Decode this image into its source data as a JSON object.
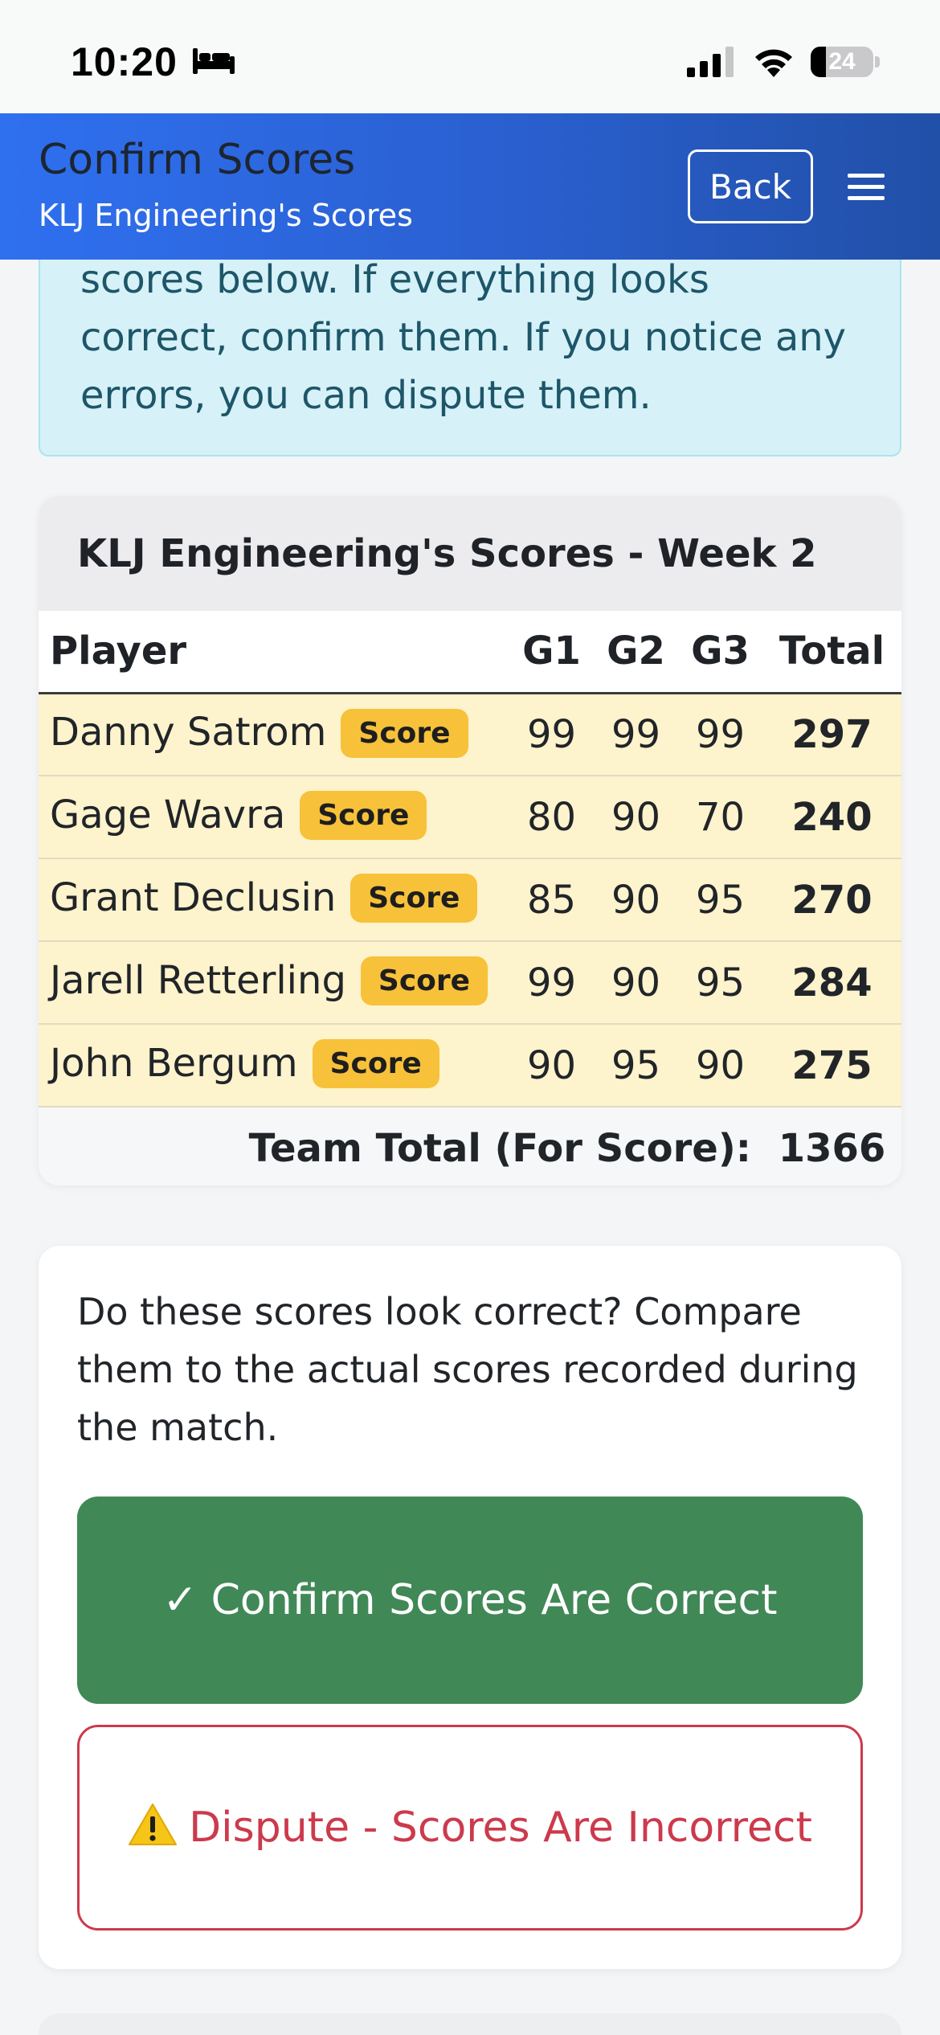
{
  "status_bar": {
    "time": "10:20",
    "battery_level": "24"
  },
  "header": {
    "title": "Confirm Scores",
    "subtitle": "KLJ Engineering's Scores",
    "back_label": "Back"
  },
  "info_alert": {
    "text": "scores below. If everything looks correct, confirm them. If you notice any errors, you can dispute them."
  },
  "scores_card": {
    "title": "KLJ Engineering's Scores - Week 2",
    "columns": [
      "Player",
      "G1",
      "G2",
      "G3",
      "Total"
    ],
    "badge_label": "Score",
    "rows": [
      {
        "player": "Danny Satrom",
        "g1": "99",
        "g2": "99",
        "g3": "99",
        "total": "297"
      },
      {
        "player": "Gage Wavra",
        "g1": "80",
        "g2": "90",
        "g3": "70",
        "total": "240"
      },
      {
        "player": "Grant Declusin",
        "g1": "85",
        "g2": "90",
        "g3": "95",
        "total": "270"
      },
      {
        "player": "Jarell Retterling",
        "g1": "99",
        "g2": "90",
        "g3": "95",
        "total": "284"
      },
      {
        "player": "John Bergum",
        "g1": "90",
        "g2": "95",
        "g3": "90",
        "total": "275"
      }
    ],
    "team_total_label": "Team Total (For Score):",
    "team_total_value": "1366"
  },
  "confirm_card": {
    "prompt": "Do these scores look correct? Compare them to the actual scores recorded during the match.",
    "confirm_label": "✓ Confirm Scores Are Correct",
    "dispute_label": "Dispute - Scores Are Incorrect"
  },
  "colors": {
    "header_gradient_start": "#2f70f0",
    "header_gradient_end": "#2150a8",
    "info_bg": "#d6f1f8",
    "row_highlight": "#fdf3cc",
    "badge": "#f7c13a",
    "confirm": "#418857",
    "dispute": "#cc3a4c"
  },
  "icons": {
    "status": [
      "bed-icon",
      "signal-icon",
      "wifi-icon",
      "battery-icon"
    ],
    "header": [
      "menu-icon"
    ],
    "dispute": "warning-icon"
  }
}
